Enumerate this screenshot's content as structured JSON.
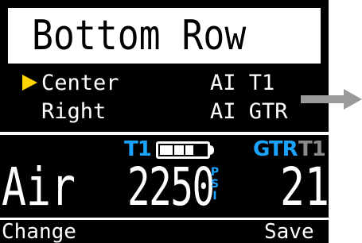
{
  "title": "Bottom Row",
  "menu": [
    {
      "label": "Center",
      "value": "AI T1",
      "selected": true
    },
    {
      "label": "Right",
      "value": "AI GTR",
      "selected": false
    }
  ],
  "status": {
    "left_tag": "T1",
    "battery_level": 0.72,
    "gtr_tag": "GTR",
    "right_tag": "T1"
  },
  "readout": {
    "gas": "Air",
    "pressure": "2250",
    "unit_letters": [
      "P",
      "S",
      "I"
    ],
    "right_value": "21"
  },
  "footer": {
    "left": "Change",
    "right": "Save"
  },
  "colors": {
    "cursor": "#ffd400",
    "accent": "#1aa3ff",
    "dim": "#8a8a8a",
    "arrow": "#9a9a9a",
    "background": "#000000",
    "foreground": "#ffffff"
  },
  "icons": {
    "cursor": "triangle-right-icon",
    "battery": "battery-icon",
    "external_arrow": "arrow-right-icon"
  }
}
